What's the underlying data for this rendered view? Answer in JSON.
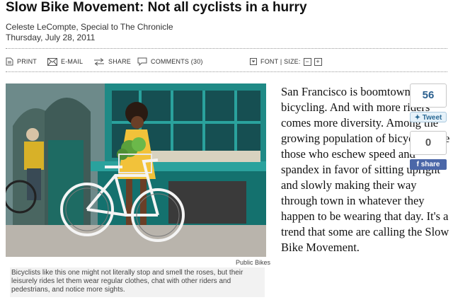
{
  "article": {
    "headline": "Slow Bike Movement: Not all cyclists in a hurry",
    "author": "Celeste LeCompte, Special to The Chronicle",
    "date": "Thursday, July 28, 2011"
  },
  "toolbar": {
    "print": "PRINT",
    "email": "E-MAIL",
    "share": "SHARE",
    "comments": "COMMENTS (30)",
    "font_size": "FONT | SIZE:",
    "decrease": "−",
    "increase": "+"
  },
  "photo": {
    "credit": "Public Bikes",
    "caption": "Bicyclists like this one might not literally stop and smell the roses, but their leisurely rides let them wear regular clothes, chat with other riders and pedestrians, and notice more sights."
  },
  "body": "San Francisco is boomtown for bicycling. And with more riders comes more diversity. Among the growing population of bicyclists are those who eschew speed and spandex in favor of sitting upright and slowly making their way through town in whatever they happen to be wearing that day. It's a trend that some are calling the Slow Bike Movement.",
  "social": {
    "tweet_count": "56",
    "tweet_label": "Tweet",
    "share_count": "0",
    "share_label": "share"
  },
  "colors": {
    "storefront_teal": "#1f8a86",
    "dress_yellow": "#f2c23a",
    "facebook_blue": "#4b67a8",
    "twitter_blue": "#2b6a95"
  }
}
